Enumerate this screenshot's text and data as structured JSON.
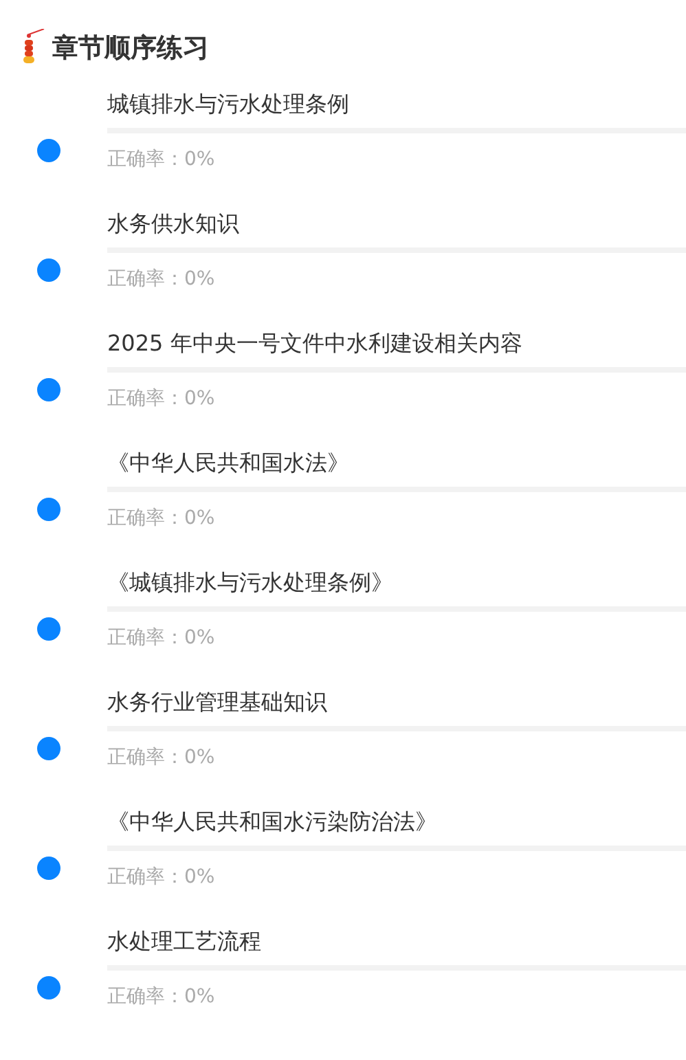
{
  "title": "章节顺序练习",
  "chapters": [
    {
      "name": "城镇排水与污水处理条例",
      "accuracy": "正确率：0%"
    },
    {
      "name": "水务供水知识",
      "accuracy": "正确率：0%"
    },
    {
      "name": "2025 年中央一号文件中水利建设相关内容",
      "accuracy": "正确率：0%"
    },
    {
      "name": "《中华人民共和国水法》",
      "accuracy": "正确率：0%"
    },
    {
      "name": "《城镇排水与污水处理条例》",
      "accuracy": "正确率：0%"
    },
    {
      "name": "水务行业管理基础知识",
      "accuracy": "正确率：0%"
    },
    {
      "name": "《中华人民共和国水污染防治法》",
      "accuracy": "正确率：0%"
    },
    {
      "name": "水处理工艺流程",
      "accuracy": "正确率：0%"
    }
  ]
}
